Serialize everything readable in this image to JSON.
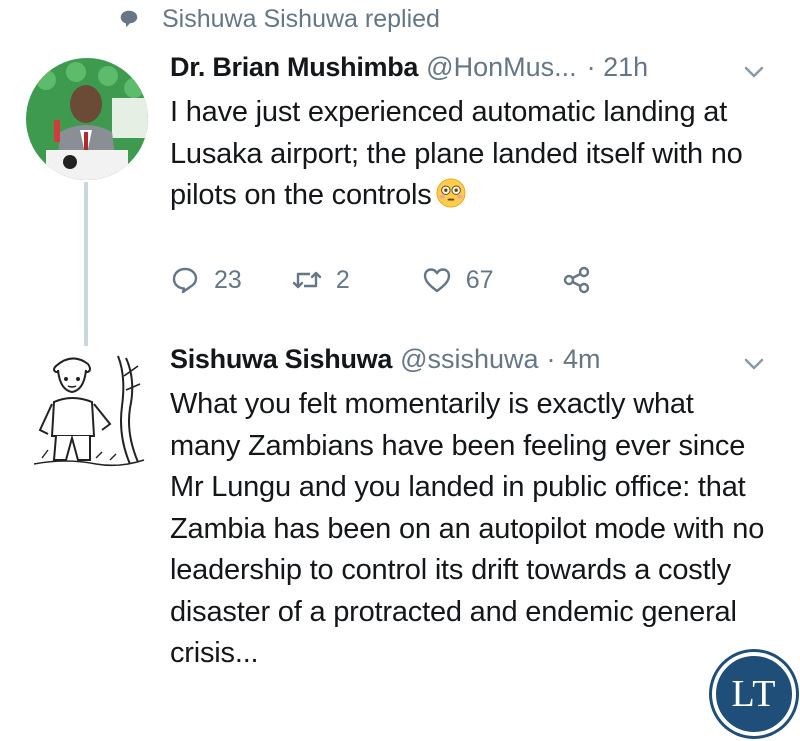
{
  "context": {
    "replied_text": "Sishuwa Sishuwa replied",
    "icon": "speech-bubble-icon"
  },
  "tweets": [
    {
      "name": "Dr. Brian Mushimba",
      "handle": "@HonMus...",
      "time": "· 21h",
      "text": "I have just experienced automatic landing at Lusaka airport; the plane landed itself with no pilots on the controls",
      "emoji": "flushed-face-icon",
      "actions": {
        "replies": "23",
        "retweets": "2",
        "likes": "67"
      }
    },
    {
      "name": "Sishuwa Sishuwa",
      "handle": "@ssishuwa",
      "time": "· 4m",
      "text": "What you felt momentarily is exactly what many Zambians have been feeling ever since Mr Lungu and you landed in public office: that Zambia has been on an autopilot mode with no leadership to control its drift towards a costly disaster of a protracted and endemic general crisis..."
    }
  ],
  "watermark": {
    "text": "LT"
  },
  "colors": {
    "secondary_text": "#657786",
    "primary_text": "#14171a",
    "thread_line": "#ccd6dd",
    "badge": "#1f4e79"
  }
}
